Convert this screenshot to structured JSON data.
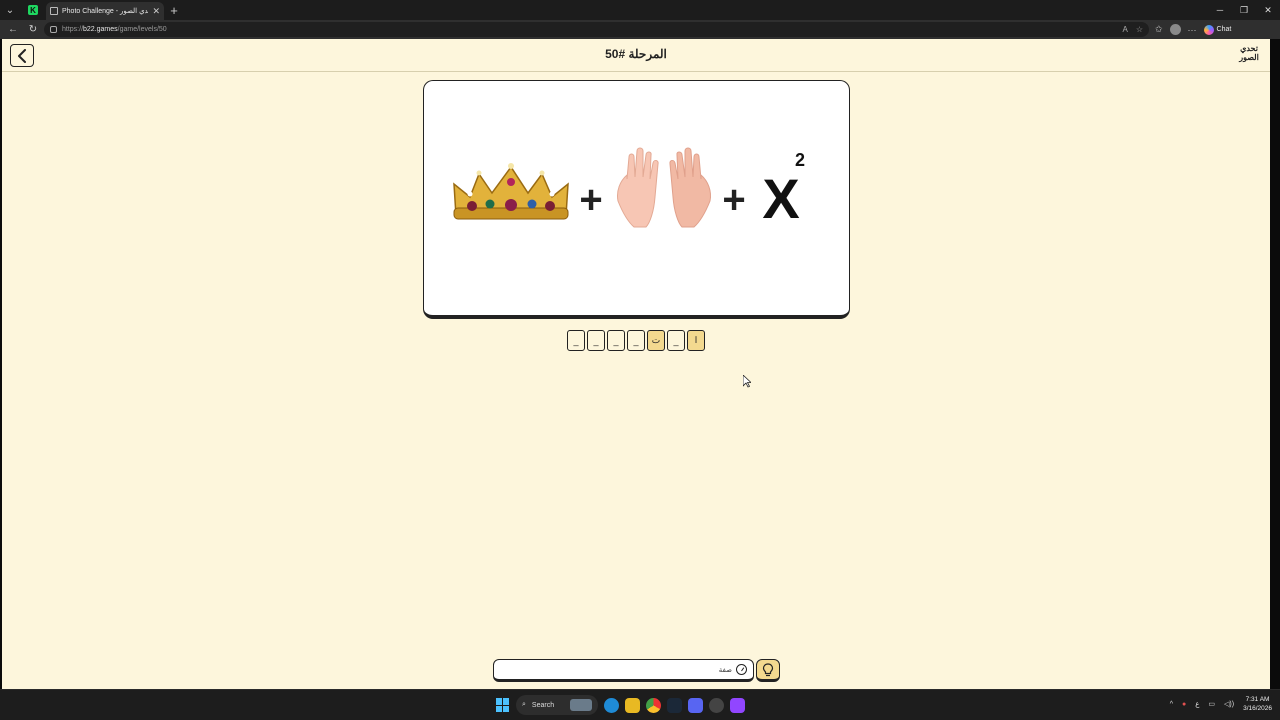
{
  "browser": {
    "tab_title": "Photo Challenge - لعبة تحدي الصور",
    "url_prefix": "https://",
    "url_domain": "b22.games",
    "url_path": "/game/levels/50",
    "chat_label": "Chat"
  },
  "game": {
    "level_title": "المرحلة #50",
    "logo_text_line1": "تحدي",
    "logo_text_line2": "الصور",
    "puzzle": {
      "operator": "+",
      "variable": "X",
      "exponent": "2"
    },
    "answer_slots": [
      "_",
      "_",
      "_",
      "_",
      "ت",
      "_",
      "ا"
    ],
    "answer_placeholder": "صفة",
    "colors": {
      "background": "#fdf6dc",
      "slot_filled": "#f3d98f"
    }
  },
  "taskbar": {
    "search_label": "Search",
    "time": "7:31 AM",
    "date": "3/16/2026",
    "lang": "ع"
  }
}
